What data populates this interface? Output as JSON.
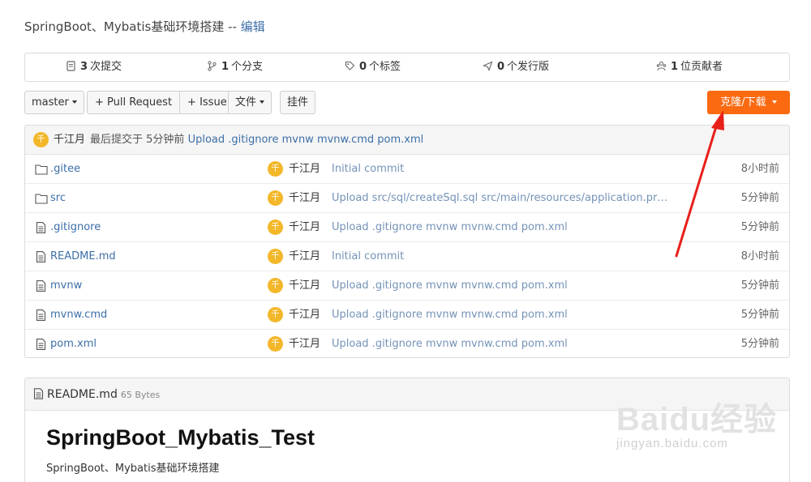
{
  "repo": {
    "description": "SpringBoot、Mybatis基础环境搭建 --",
    "edit_label": "编辑"
  },
  "stats": {
    "commits": {
      "count": "3",
      "label": "次提交",
      "icon": "commit-icon"
    },
    "branches": {
      "count": "1",
      "label": "个分支",
      "icon": "branch-icon"
    },
    "tags": {
      "count": "0",
      "label": "个标签",
      "icon": "tag-icon"
    },
    "releases": {
      "count": "0",
      "label": "个发行版",
      "icon": "release-icon"
    },
    "contributors": {
      "count": "1",
      "label": "位贡献者",
      "icon": "contributors-icon"
    }
  },
  "toolbar": {
    "branch": "master",
    "pull_request": "+ Pull Request",
    "issue": "+ Issue",
    "file": "文件",
    "widget": "挂件",
    "clone": "克隆/下载",
    "clone_color": "#fb6a11"
  },
  "last_commit": {
    "avatar": "千",
    "author": "千江月",
    "prefix": "最后提交于 5分钟前",
    "message": "Upload .gitignore mvnw mvnw.cmd pom.xml"
  },
  "files": [
    {
      "name": ".gitee",
      "type": "folder",
      "avatar": "千",
      "author": "千江月",
      "message": "Initial commit",
      "time": "8小时前"
    },
    {
      "name": "src",
      "type": "folder",
      "avatar": "千",
      "author": "千江月",
      "message": "Upload src/sql/createSql.sql src/main/resources/application.properties...",
      "time": "5分钟前"
    },
    {
      "name": ".gitignore",
      "type": "file",
      "avatar": "千",
      "author": "千江月",
      "message": "Upload .gitignore mvnw mvnw.cmd pom.xml",
      "time": "5分钟前"
    },
    {
      "name": "README.md",
      "type": "file",
      "avatar": "千",
      "author": "千江月",
      "message": "Initial commit",
      "time": "8小时前"
    },
    {
      "name": "mvnw",
      "type": "file",
      "avatar": "千",
      "author": "千江月",
      "message": "Upload .gitignore mvnw mvnw.cmd pom.xml",
      "time": "5分钟前"
    },
    {
      "name": "mvnw.cmd",
      "type": "file",
      "avatar": "千",
      "author": "千江月",
      "message": "Upload .gitignore mvnw mvnw.cmd pom.xml",
      "time": "5分钟前"
    },
    {
      "name": "pom.xml",
      "type": "file",
      "avatar": "千",
      "author": "千江月",
      "message": "Upload .gitignore mvnw mvnw.cmd pom.xml",
      "time": "5分钟前"
    }
  ],
  "readme": {
    "filename": "README.md",
    "size": "65 Bytes",
    "title": "SpringBoot_Mybatis_Test",
    "description": "SpringBoot、Mybatis基础环境搭建"
  },
  "watermark": {
    "logo": "Baidu经验",
    "url": "jingyan.baidu.com"
  },
  "annotation": {
    "arrow_color": "#e8201a"
  }
}
